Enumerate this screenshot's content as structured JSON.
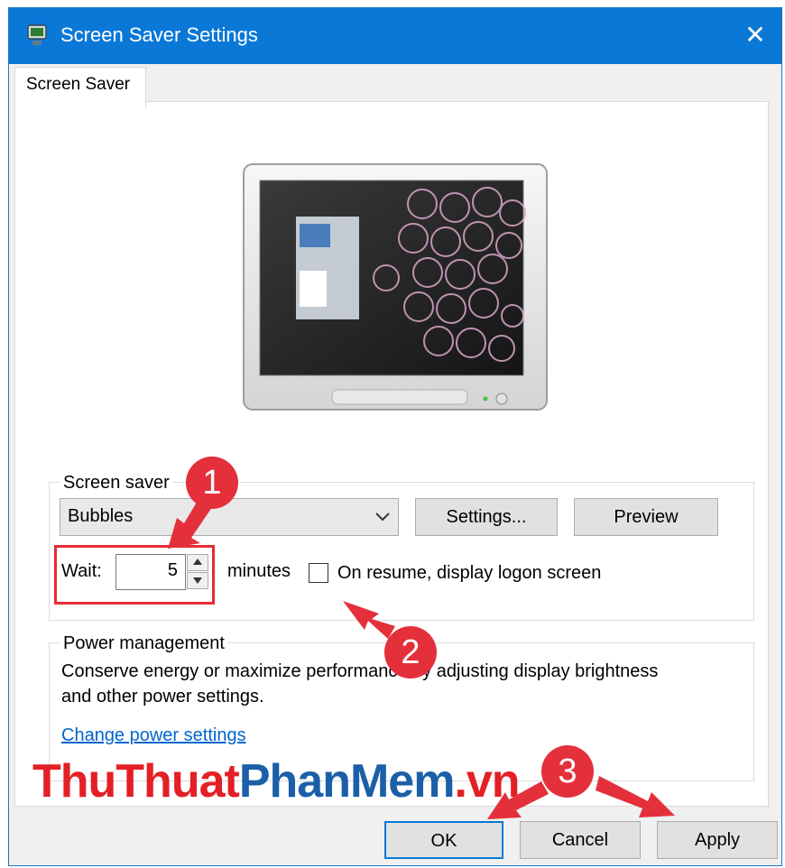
{
  "window": {
    "title": "Screen Saver Settings",
    "close_glyph": "✕"
  },
  "tab": {
    "label": "Screen Saver"
  },
  "screen_saver_group": {
    "label": "Screen saver",
    "selected": "Bubbles",
    "settings_label": "Settings...",
    "preview_label": "Preview",
    "wait_label": "Wait:",
    "wait_value": "5",
    "minutes_label": "minutes",
    "resume_label": "On resume, display logon screen",
    "resume_checked": false
  },
  "power_group": {
    "label": "Power management",
    "description": "Conserve energy or maximize performance by adjusting display brightness and other power settings.",
    "link": "Change power settings"
  },
  "buttons": {
    "ok": "OK",
    "cancel": "Cancel",
    "apply": "Apply"
  },
  "watermark": {
    "part1": "ThuThuat",
    "part2": "PhanMem",
    "part3": ".vn"
  },
  "annotations": {
    "badge1": "1",
    "badge2": "2",
    "badge3": "3"
  },
  "colors": {
    "accent": "#0a78d7",
    "annotation": "#e3303b",
    "link": "#0066cc"
  },
  "icons": [
    "screen-saver-icon",
    "close-icon",
    "chevron-down-icon",
    "spin-up-icon",
    "spin-down-icon"
  ]
}
